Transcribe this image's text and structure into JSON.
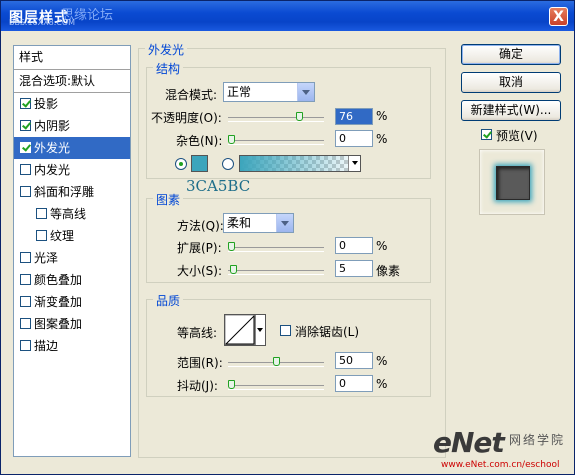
{
  "window": {
    "title": "图层样式",
    "watermark_top": "思缘论坛",
    "watermark_url": "BBS.16XX8.COM",
    "close_glyph": "X"
  },
  "styles_list": {
    "header": "样式",
    "blend_item": "混合选项:默认",
    "items": [
      {
        "label": "投影",
        "checked": true
      },
      {
        "label": "内阴影",
        "checked": true
      },
      {
        "label": "外发光",
        "checked": true,
        "selected": true
      },
      {
        "label": "内发光",
        "checked": false
      },
      {
        "label": "斜面和浮雕",
        "checked": false
      },
      {
        "label": "等高线",
        "checked": false,
        "sub": true
      },
      {
        "label": "纹理",
        "checked": false,
        "sub": true
      },
      {
        "label": "光泽",
        "checked": false
      },
      {
        "label": "颜色叠加",
        "checked": false
      },
      {
        "label": "渐变叠加",
        "checked": false
      },
      {
        "label": "图案叠加",
        "checked": false
      },
      {
        "label": "描边",
        "checked": false
      }
    ]
  },
  "outer_glow": {
    "section_title": "外发光",
    "structure": {
      "title": "结构",
      "blend_mode_label": "混合模式:",
      "blend_mode_value": "正常",
      "opacity_label": "不透明度(O):",
      "opacity_value": "76",
      "opacity_unit": "%",
      "noise_label": "杂色(N):",
      "noise_value": "0",
      "noise_unit": "%",
      "color_swatch": "#3ca5bc",
      "color_annotation": "3CA5BC",
      "opacity_level": 76,
      "noise_level": 0
    },
    "elements": {
      "title": "图素",
      "method_label": "方法(Q):",
      "method_value": "柔和",
      "spread_label": "扩展(P):",
      "spread_value": "0",
      "spread_unit": "%",
      "size_label": "大小(S):",
      "size_value": "5",
      "size_unit": "像素",
      "spread_level": 0,
      "size_level": 5
    },
    "quality": {
      "title": "品质",
      "contour_label": "等高线:",
      "antialias_label": "消除锯齿(L)",
      "range_label": "范围(R):",
      "range_value": "50",
      "range_unit": "%",
      "jitter_label": "抖动(J):",
      "jitter_value": "0",
      "jitter_unit": "%",
      "range_level": 50,
      "jitter_level": 0
    }
  },
  "buttons": {
    "ok": "确定",
    "cancel": "取消",
    "new_style": "新建样式(W)...",
    "preview": "预览(V)"
  },
  "footer_watermark": {
    "logo": "eNet",
    "slogan": "网络学院",
    "url": "www.eNet.com.cn/eschool"
  }
}
